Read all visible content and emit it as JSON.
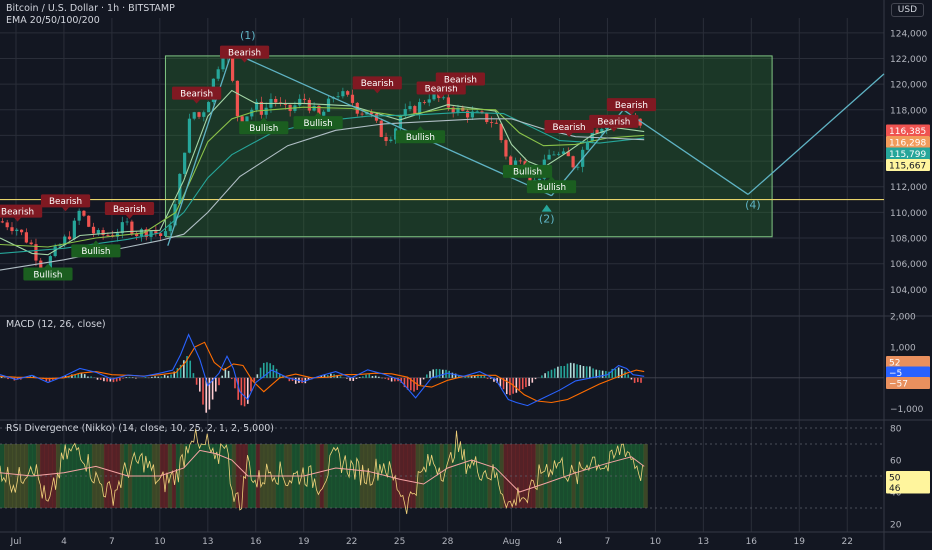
{
  "header": {
    "symbol": "Bitcoin / U.S. Dollar · 1h · BITSTAMP",
    "indicator": "EMA 20/50/100/200",
    "currency": "USD"
  },
  "macd_header": "MACD (12, 26, close)",
  "rsi_header": "RSI Divergence (Nikko) (14, close, 10, 25, 2, 1, 2, 5,000)",
  "colors": {
    "bg": "#131722",
    "grid": "#2a2e39",
    "axis_text": "#b2b5be",
    "bull_candle": "#26a69a",
    "bear_candle": "#ef5350",
    "box_fill": "#2e7d32",
    "box_border": "#81c784",
    "support_line": "#e6d36a",
    "projection": "#5fb3c4",
    "bearish_label": "#801922",
    "bullish_label": "#1b5e20",
    "ema20": "#a5d6a7",
    "ema50": "#8bc34a",
    "ema100": "#26a69a",
    "ema200": "#b0bec5",
    "macd": "#2962ff",
    "signal": "#ff6d00",
    "rsi": "#f1d27a"
  },
  "chart_data": [
    {
      "type": "line",
      "pane": "price",
      "title": "",
      "x_axis": {
        "labels": [
          "Jul",
          "4",
          "7",
          "10",
          "13",
          "16",
          "19",
          "22",
          "25",
          "28",
          "Aug",
          "4",
          "7",
          "10",
          "13",
          "16",
          "19",
          "22"
        ],
        "x": [
          1,
          4,
          7,
          10,
          13,
          16,
          19,
          22,
          25,
          28,
          32,
          35,
          38,
          41,
          44,
          47,
          50,
          53
        ]
      },
      "ylim": [
        102000,
        125000
      ],
      "y_ticks": [
        104000,
        106000,
        108000,
        110000,
        112000,
        114000,
        116000,
        118000,
        120000,
        122000,
        124000
      ],
      "y_tick_labels": [
        "104,000",
        "106,000",
        "108,000",
        "110,000",
        "112,000",
        "114,000",
        "116,000",
        "118,000",
        "120,000",
        "122,000",
        "124,000"
      ],
      "series": [
        {
          "key": "price",
          "x": [
            0.0,
            1.0,
            2.0,
            2.7,
            3.0,
            4.0,
            4.5,
            5.0,
            5.5,
            6.0,
            7.0,
            8.0,
            8.5,
            9.5,
            10.3,
            10.6,
            11.0,
            11.5,
            12.0,
            12.5,
            13.0,
            13.5,
            14.0,
            14.3,
            15.0,
            15.5,
            16.0,
            16.5,
            17.0,
            17.5,
            18.0,
            19.0,
            20.0,
            21.0,
            22.0,
            22.5,
            23.0,
            24.0,
            24.6,
            25.0,
            26.0,
            27.0,
            27.8,
            28.5,
            29.0,
            30.0,
            31.0,
            32.0,
            32.5,
            33.0,
            33.5,
            34.5,
            35.0,
            35.5,
            36.0,
            36.5,
            37.0,
            37.5,
            38.0,
            38.5,
            39.0,
            39.5,
            40.0,
            40.3
          ],
          "values": [
            109300,
            108800,
            107400,
            105300,
            106200,
            107800,
            108500,
            110200,
            109000,
            108200,
            108300,
            109100,
            108400,
            108600,
            108000,
            109100,
            110700,
            114700,
            118000,
            117400,
            118700,
            121000,
            122700,
            122100,
            116400,
            117800,
            118300,
            117800,
            119000,
            118300,
            117800,
            118900,
            117300,
            119400,
            118700,
            117800,
            118000,
            115800,
            116200,
            117500,
            118100,
            119300,
            118500,
            118000,
            117800,
            117500,
            117000,
            113200,
            114600,
            113000,
            112300,
            114800,
            114400,
            114300,
            113500,
            115000,
            116800,
            116400,
            117000,
            117300,
            116900,
            117500,
            116600,
            116385
          ]
        },
        {
          "key": "ema20",
          "name": "EMA 20",
          "x": [
            0,
            2,
            3,
            5,
            8,
            10,
            11.5,
            13,
            14.5,
            16,
            19,
            22,
            25,
            28,
            31,
            32,
            33,
            34,
            35.5,
            37,
            38.5,
            40.3
          ],
          "values": [
            108000,
            106800,
            106700,
            108200,
            108500,
            108600,
            112500,
            117500,
            119500,
            118500,
            118500,
            118300,
            117200,
            118400,
            117900,
            115300,
            114000,
            113500,
            114700,
            116000,
            116600,
            116298
          ]
        },
        {
          "key": "ema50",
          "name": "EMA 50",
          "x": [
            0,
            3,
            6,
            9,
            11,
            12,
            13,
            14.5,
            16,
            19,
            22,
            25,
            28,
            31,
            32.5,
            34,
            36,
            38,
            40.3
          ],
          "values": [
            107500,
            107300,
            108000,
            108400,
            110000,
            112700,
            115500,
            117300,
            117900,
            118200,
            118100,
            117500,
            118100,
            118000,
            116200,
            115200,
            115300,
            115800,
            116000
          ]
        },
        {
          "key": "ema100",
          "name": "EMA 100",
          "x": [
            0,
            4,
            8,
            10,
            11.5,
            13,
            14.5,
            17,
            20,
            23,
            26,
            29,
            31.5,
            33,
            35,
            37.5,
            40.3
          ],
          "values": [
            106800,
            107200,
            107900,
            108400,
            110000,
            112700,
            114500,
            116200,
            117100,
            117500,
            117600,
            117800,
            117700,
            116800,
            115600,
            115400,
            115799
          ]
        },
        {
          "key": "ema200",
          "name": "EMA 200",
          "x": [
            0,
            4,
            8,
            10,
            11.5,
            13,
            15,
            18,
            21,
            24,
            27,
            30,
            32,
            34,
            36,
            38,
            40.3
          ],
          "values": [
            105500,
            106300,
            107300,
            107800,
            108300,
            110000,
            112800,
            115200,
            116400,
            116900,
            117100,
            117300,
            117300,
            116500,
            115900,
            115800,
            115667
          ]
        }
      ],
      "price_labels": [
        {
          "value": 116385,
          "text": "116,385",
          "color": "#ef5350"
        },
        {
          "value": 116298,
          "text": "116,298",
          "color": "#f29b5b"
        },
        {
          "value": 115799,
          "text": "115,799",
          "color": "#26a69a"
        },
        {
          "value": 115667,
          "text": "115,667",
          "color": "#fff59d"
        }
      ],
      "range_box": {
        "x0": 10.35,
        "x1": 48.3,
        "y0": 108100,
        "y1": 122200
      },
      "support_level": 111000,
      "trendlines": [
        {
          "points": [
            [
              10.5,
              107400
            ],
            [
              14.5,
              122500
            ]
          ]
        },
        {
          "points": [
            [
              14.5,
              122500
            ],
            [
              34.5,
              111300
            ]
          ]
        },
        {
          "points": [
            [
              34.5,
              111300
            ],
            [
              39.0,
              118000
            ]
          ]
        },
        {
          "points": [
            [
              39.0,
              118000
            ],
            [
              46.8,
              111400
            ]
          ]
        },
        {
          "points": [
            [
              46.8,
              111400
            ],
            [
              55.3,
              120800
            ]
          ]
        }
      ],
      "annotations": [
        {
          "kind": "bearish",
          "text": "Bearish",
          "x": 1.1,
          "y": 110100
        },
        {
          "kind": "bearish",
          "text": "Bearish",
          "x": 4.1,
          "y": 110900
        },
        {
          "kind": "bearish",
          "text": "Bearish",
          "x": 8.1,
          "y": 110300
        },
        {
          "kind": "bearish",
          "text": "Bearish",
          "x": 12.3,
          "y": 119300
        },
        {
          "kind": "bearish",
          "text": "Bearish",
          "x": 15.3,
          "y": 122500
        },
        {
          "kind": "bearish",
          "text": "Bearish",
          "x": 23.6,
          "y": 120100
        },
        {
          "kind": "bearish",
          "text": "Bearish",
          "x": 27.6,
          "y": 119700
        },
        {
          "kind": "bearish",
          "text": "Bearish",
          "x": 28.8,
          "y": 120400
        },
        {
          "kind": "bearish",
          "text": "Bearish",
          "x": 35.6,
          "y": 116700
        },
        {
          "kind": "bearish",
          "text": "Bearish",
          "x": 38.4,
          "y": 117100
        },
        {
          "kind": "bearish",
          "text": "Bearish",
          "x": 39.5,
          "y": 118400
        },
        {
          "kind": "bullish",
          "text": "Bullish",
          "x": 3.0,
          "y": 105200
        },
        {
          "kind": "bullish",
          "text": "Bullish",
          "x": 6.0,
          "y": 107000
        },
        {
          "kind": "bullish",
          "text": "Bullish",
          "x": 16.5,
          "y": 116600
        },
        {
          "kind": "bullish",
          "text": "Bullish",
          "x": 19.9,
          "y": 117000
        },
        {
          "kind": "bullish",
          "text": "Bullish",
          "x": 26.3,
          "y": 115900
        },
        {
          "kind": "bullish",
          "text": "Bullish",
          "x": 33.0,
          "y": 113200
        },
        {
          "kind": "bullish",
          "text": "Bullish",
          "x": 34.5,
          "y": 112000
        }
      ],
      "wave_labels": [
        {
          "text": "(1)",
          "x": 15.5,
          "y": 123500
        },
        {
          "text": "(2)",
          "x": 34.2,
          "y": 109200
        },
        {
          "text": "(4)",
          "x": 47.1,
          "y": 110300
        }
      ]
    },
    {
      "type": "line",
      "pane": "macd",
      "title": "MACD (12, 26, close)",
      "ylim": [
        -1300,
        2000
      ],
      "y_ticks": [
        2000,
        1000,
        0,
        -1000
      ],
      "y_tick_labels": [
        "2,000",
        "1,000",
        "0",
        "−1,000"
      ],
      "series": [
        {
          "key": "macd",
          "name": "MACD",
          "x": [
            0,
            1,
            2,
            3,
            4,
            5,
            6,
            7,
            8,
            9,
            10,
            10.8,
            11.3,
            11.8,
            12.5,
            13,
            13.7,
            14.2,
            14.6,
            15,
            15.5,
            16,
            17,
            18,
            19,
            20,
            21,
            22,
            23,
            24,
            25,
            25.5,
            26,
            27,
            28,
            29,
            30,
            31,
            31.8,
            32.3,
            33,
            34,
            35,
            36,
            37,
            38,
            38.7,
            39.2,
            39.6,
            40.3
          ],
          "values": [
            100,
            -50,
            80,
            -150,
            50,
            300,
            180,
            -40,
            90,
            50,
            150,
            250,
            750,
            1400,
            600,
            -250,
            150,
            700,
            300,
            -450,
            -700,
            -150,
            250,
            0,
            -120,
            60,
            200,
            0,
            260,
            120,
            -60,
            -350,
            -650,
            0,
            150,
            50,
            200,
            -50,
            -700,
            -800,
            -900,
            -650,
            -400,
            -100,
            0,
            100,
            400,
            300,
            100,
            50
          ]
        },
        {
          "key": "signal",
          "name": "Signal",
          "x": [
            0,
            1,
            2,
            3,
            4,
            5,
            6,
            7,
            8,
            9,
            10,
            11,
            11.6,
            12.2,
            12.8,
            13.4,
            14,
            14.6,
            15.2,
            15.8,
            16.5,
            17.5,
            18.5,
            19.5,
            20.5,
            21.5,
            22.5,
            23.5,
            24.5,
            25.5,
            26.2,
            27,
            28,
            29,
            30,
            31,
            32,
            32.8,
            33.6,
            34.5,
            35.5,
            36.5,
            37.5,
            38.5,
            39.2,
            39.8,
            40.3
          ],
          "values": [
            50,
            20,
            10,
            -30,
            0,
            150,
            200,
            100,
            80,
            60,
            100,
            170,
            500,
            1000,
            1150,
            500,
            250,
            450,
            400,
            -100,
            -450,
            0,
            120,
            0,
            20,
            100,
            110,
            150,
            130,
            20,
            -250,
            -300,
            -80,
            50,
            80,
            80,
            -200,
            -550,
            -750,
            -800,
            -700,
            -450,
            -200,
            0,
            150,
            250,
            200
          ]
        },
        {
          "key": "hist",
          "name": "Histogram"
        }
      ],
      "value_labels": [
        {
          "value": 52,
          "text": "52",
          "color": "#e9905e"
        },
        {
          "value": -5,
          "text": "−5",
          "color": "#2962ff"
        },
        {
          "value": -57,
          "text": "−57",
          "color": "#e9905e"
        }
      ]
    },
    {
      "type": "line",
      "pane": "rsi",
      "title": "RSI Divergence (Nikko) (14, close, 10, 25, 2, 1, 2, 5,000)",
      "ylim": [
        15,
        85
      ],
      "y_ticks": [
        80,
        60,
        40,
        20
      ],
      "y_tick_labels": [
        "80",
        "60",
        "40",
        "20"
      ],
      "band": [
        30,
        70
      ],
      "series": [
        {
          "key": "rsi",
          "name": "RSI",
          "x": [
            0,
            1,
            2,
            3,
            4,
            5,
            6,
            7,
            8,
            9,
            10,
            11,
            11.5,
            12,
            12.5,
            13,
            13.5,
            14,
            14.5,
            15,
            15.5,
            16,
            17,
            18,
            19,
            20,
            21,
            22,
            23,
            24,
            25,
            25.5,
            26,
            27,
            28,
            28.5,
            29,
            30,
            31,
            32,
            32.5,
            33,
            34,
            35,
            36,
            37,
            38,
            39,
            39.5,
            40.3
          ],
          "values": [
            55,
            45,
            60,
            30,
            62,
            68,
            48,
            38,
            55,
            60,
            45,
            50,
            62,
            78,
            65,
            70,
            55,
            76,
            45,
            30,
            60,
            45,
            55,
            48,
            52,
            45,
            62,
            55,
            50,
            58,
            42,
            32,
            45,
            60,
            52,
            72,
            60,
            55,
            50,
            30,
            40,
            35,
            55,
            58,
            48,
            62,
            55,
            70,
            62,
            49
          ]
        },
        {
          "key": "rsi_ma",
          "name": "RSI MA",
          "x": [
            0,
            2,
            4,
            6,
            8,
            10,
            11.5,
            12.5,
            13.5,
            14.5,
            15.5,
            17,
            19,
            21,
            23,
            25,
            26.5,
            28,
            29.5,
            31,
            32.5,
            34,
            36,
            38,
            39.5,
            40.3
          ],
          "values": [
            52,
            50,
            52,
            56,
            50,
            50,
            55,
            66,
            64,
            60,
            50,
            50,
            50,
            55,
            53,
            48,
            45,
            55,
            60,
            55,
            40,
            45,
            52,
            58,
            62,
            56
          ]
        }
      ],
      "value_labels": [
        {
          "value": 50,
          "text": "50",
          "color": "#fff59d"
        },
        {
          "value": 46,
          "text": "46",
          "color": "#fff59d"
        }
      ]
    }
  ]
}
